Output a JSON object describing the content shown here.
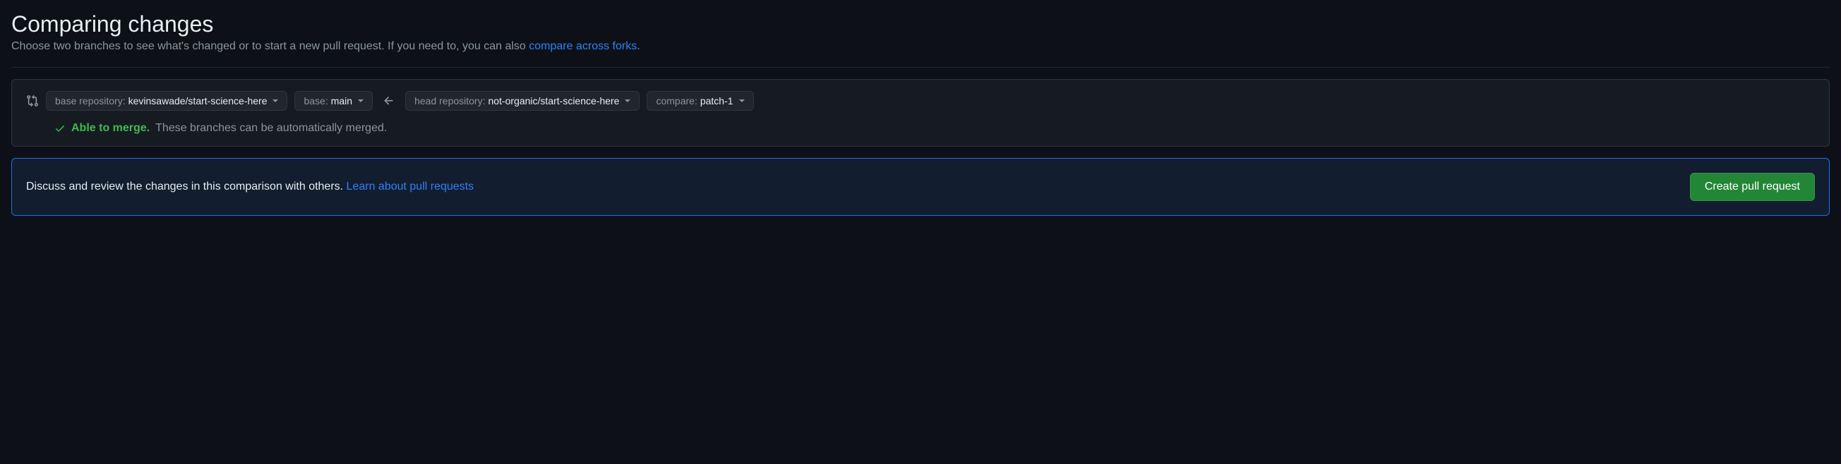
{
  "header": {
    "title": "Comparing changes",
    "subtitle_pre": "Choose two branches to see what's changed or to start a new pull request. If you need to, you can also ",
    "subtitle_link": "compare across forks",
    "subtitle_post": "."
  },
  "compare": {
    "base_repo_label": "base repository: ",
    "base_repo_value": "kevinsawade/start-science-here",
    "base_label": "base: ",
    "base_value": "main",
    "head_repo_label": "head repository: ",
    "head_repo_value": "not-organic/start-science-here",
    "compare_label": "compare: ",
    "compare_value": "patch-1"
  },
  "merge": {
    "status": "Able to merge.",
    "detail": "These branches can be automatically merged."
  },
  "pr": {
    "text": "Discuss and review the changes in this comparison with others. ",
    "link": "Learn about pull requests",
    "button": "Create pull request"
  }
}
